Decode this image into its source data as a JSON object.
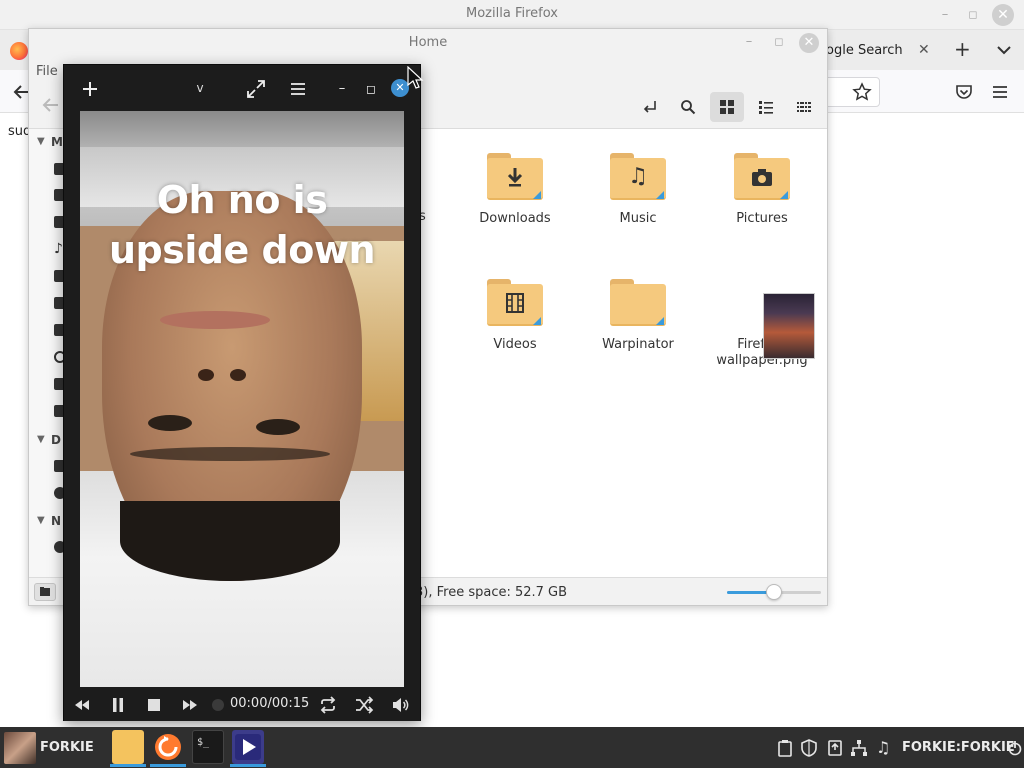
{
  "firefox": {
    "window_title": "Mozilla Firefox",
    "menu_file": "File",
    "tab_label": "ogle Search",
    "page_text": "sud",
    "icons": {
      "back": "back-arrow-icon",
      "pocket": "pocket-icon",
      "menu": "hamburger-menu-icon",
      "bookmark": "star-icon"
    }
  },
  "nemo": {
    "window_title": "Home",
    "menu_file": "File",
    "sidebar_sections": [
      "M",
      "D",
      "N"
    ],
    "items": [
      {
        "label": "Downloads",
        "icon": "download-folder-icon"
      },
      {
        "label": "Music",
        "icon": "music-folder-icon"
      },
      {
        "label": "Pictures",
        "icon": "pictures-folder-icon"
      },
      {
        "label": "Videos",
        "icon": "videos-folder-icon"
      },
      {
        "label": "Warpinator",
        "icon": "folder-icon"
      },
      {
        "label": "Firefox_ wallpaper.png",
        "icon": "image-file-icon"
      }
    ],
    "status_text": "3), Free space: 52.7 GB",
    "zoom_level_fraction": 0.5,
    "partial_label": "s"
  },
  "player": {
    "title_toggle": "v",
    "caption_line1": "Oh no is",
    "caption_line2": "upside down",
    "time": "00:00/00:15",
    "progress_fraction": 0.0,
    "accent": "#3d8fd0"
  },
  "taskbar": {
    "user_name": "FORKIE",
    "clock_text": "FORKIE:FORKIE",
    "apps": [
      "file-manager",
      "firefox-store",
      "terminal",
      "media-player"
    ],
    "accent": "#3a9bdc"
  }
}
